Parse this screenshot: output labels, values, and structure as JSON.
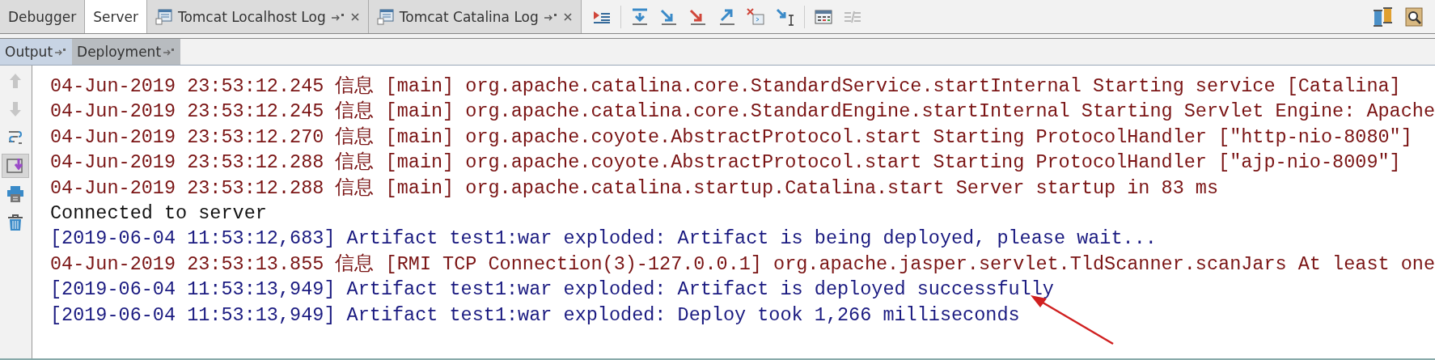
{
  "tabs": [
    {
      "label": "Debugger",
      "selected": false,
      "kind": "plain"
    },
    {
      "label": "Server",
      "selected": true,
      "kind": "plain"
    },
    {
      "label": "Tomcat Localhost Log",
      "selected": false,
      "kind": "log"
    },
    {
      "label": "Tomcat Catalina Log",
      "selected": false,
      "kind": "log"
    }
  ],
  "sub_tabs": [
    {
      "label": "Output",
      "selected": true
    },
    {
      "label": "Deployment",
      "selected": false
    }
  ],
  "side_toolbar": [
    {
      "kind": "up",
      "disabled": true,
      "on": false
    },
    {
      "kind": "down",
      "disabled": true,
      "on": false
    },
    {
      "kind": "wrap",
      "disabled": false,
      "on": false
    },
    {
      "kind": "scroll",
      "disabled": false,
      "on": true
    },
    {
      "kind": "print",
      "disabled": false,
      "on": false
    },
    {
      "kind": "trash",
      "disabled": false,
      "on": false
    }
  ],
  "log_lines": [
    {
      "kind": "info",
      "text": "04-Jun-2019 23:53:12.245 信息 [main] org.apache.catalina.core.StandardService.startInternal Starting service [Catalina]"
    },
    {
      "kind": "info",
      "text": "04-Jun-2019 23:53:12.245 信息 [main] org.apache.catalina.core.StandardEngine.startInternal Starting Servlet Engine: Apache"
    },
    {
      "kind": "info",
      "text": "04-Jun-2019 23:53:12.270 信息 [main] org.apache.coyote.AbstractProtocol.start Starting ProtocolHandler [\"http-nio-8080\"]"
    },
    {
      "kind": "info",
      "text": "04-Jun-2019 23:53:12.288 信息 [main] org.apache.coyote.AbstractProtocol.start Starting ProtocolHandler [\"ajp-nio-8009\"]"
    },
    {
      "kind": "info",
      "text": "04-Jun-2019 23:53:12.288 信息 [main] org.apache.catalina.startup.Catalina.start Server startup in 83 ms"
    },
    {
      "kind": "plain",
      "text": "Connected to server"
    },
    {
      "kind": "artifact",
      "text": "[2019-06-04 11:53:12,683] Artifact test1:war exploded: Artifact is being deployed, please wait..."
    },
    {
      "kind": "info",
      "text": "04-Jun-2019 23:53:13.855 信息 [RMI TCP Connection(3)-127.0.0.1] org.apache.jasper.servlet.TldScanner.scanJars At least one"
    },
    {
      "kind": "artifact",
      "text": "[2019-06-04 11:53:13,949] Artifact test1:war exploded: Artifact is deployed successfully"
    },
    {
      "kind": "artifact",
      "text": "[2019-06-04 11:53:13,949] Artifact test1:war exploded: Deploy took 1,266 milliseconds"
    }
  ]
}
